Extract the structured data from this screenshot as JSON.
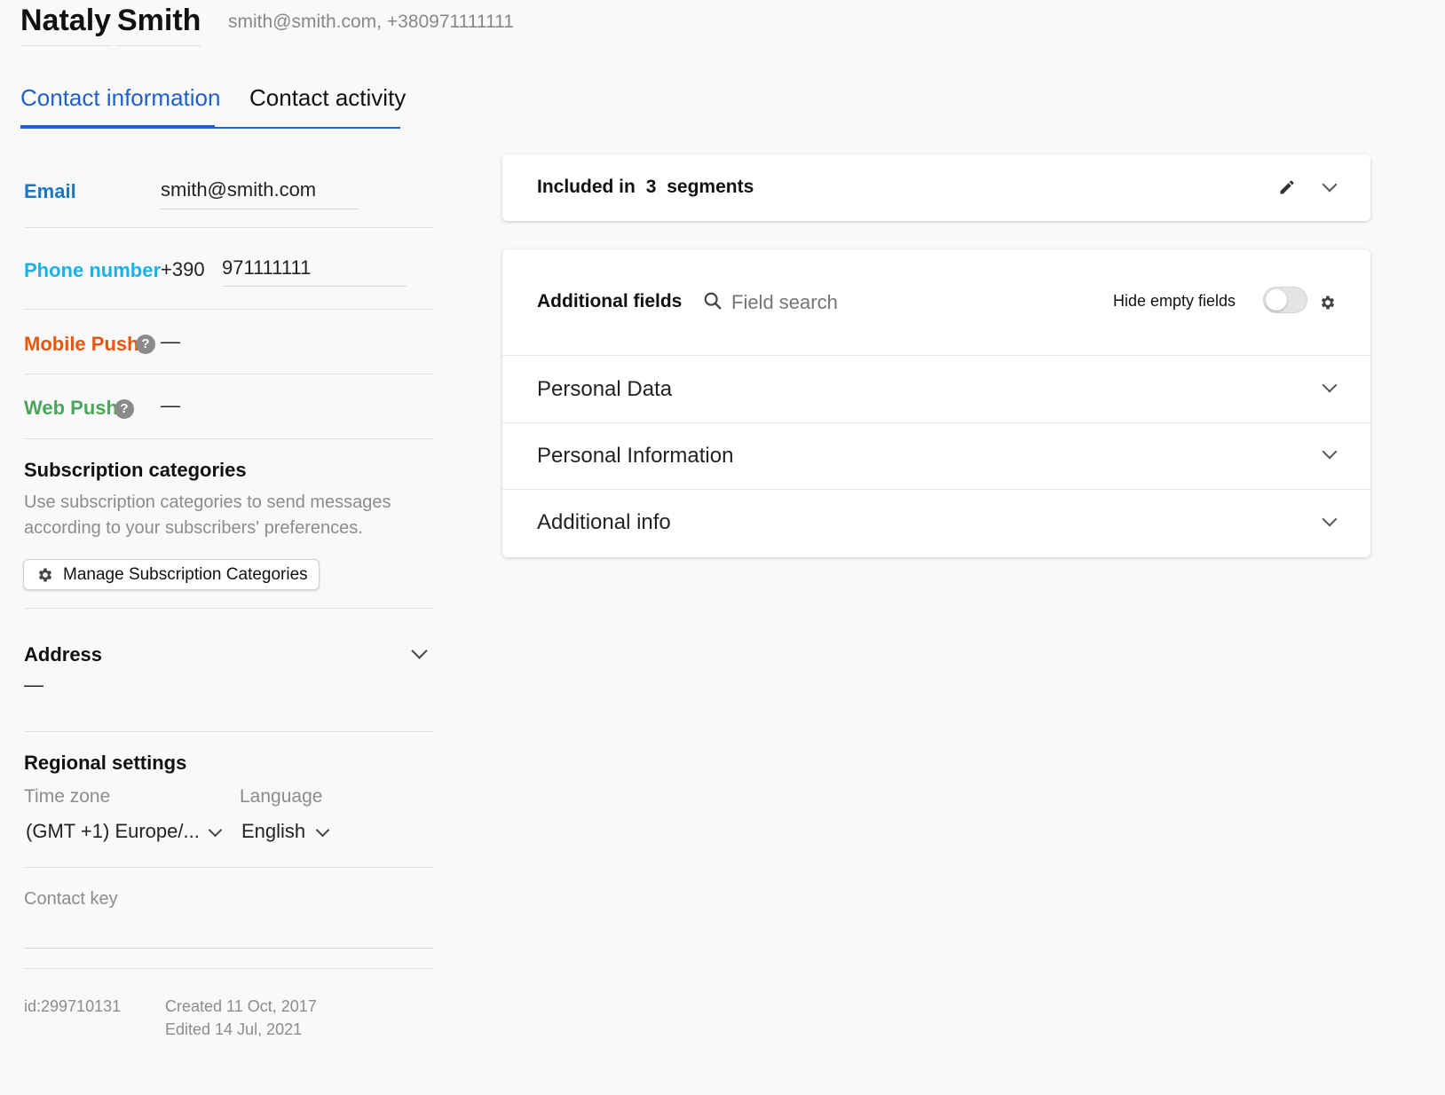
{
  "header": {
    "first_name": "Nataly",
    "last_name": "Smith",
    "contact_summary": "smith@smith.com, +380971111111"
  },
  "tabs": [
    {
      "label": "Contact information",
      "active": true
    },
    {
      "label": "Contact activity",
      "active": false
    }
  ],
  "colors": {
    "accent": "#1f5fcf",
    "email_label": "#1b76c4",
    "phone_label": "#1ab0e8",
    "mobile_push_label": "#e5570e",
    "web_push_label": "#4aa65a"
  },
  "contact": {
    "email_label": "Email",
    "email_value": "smith@smith.com",
    "phone_label": "Phone number",
    "phone_code": "+390",
    "phone_number": "971111111",
    "mobile_push_label": "Mobile Push",
    "mobile_push_value": "—",
    "web_push_label": "Web Push",
    "web_push_value": "—",
    "help_glyph": "?"
  },
  "subscription": {
    "title": "Subscription categories",
    "description_line1": "Use subscription categories to send messages",
    "description_line2": "according to your subscribers' preferences.",
    "button_label": "Manage Subscription Categories",
    "button_icon": "gear-icon"
  },
  "address": {
    "title": "Address",
    "value": "—"
  },
  "regional": {
    "title": "Regional settings",
    "timezone_label": "Time zone",
    "timezone_value": "(GMT +1) Europe/...",
    "language_label": "Language",
    "language_value": "English"
  },
  "contact_key": {
    "label": "Contact key"
  },
  "meta": {
    "id": "id:299710131",
    "created": "Created 11 Oct, 2017",
    "edited": "Edited 14 Jul, 2021"
  },
  "segments": {
    "prefix": "Included in",
    "count": "3",
    "suffix": "segments",
    "edit_icon": "pencil-icon",
    "expand_icon": "chevron-down-icon"
  },
  "additional_fields": {
    "title": "Additional fields",
    "search_placeholder": "Field search",
    "hide_empty_label": "Hide empty fields",
    "hide_empty_enabled": false,
    "settings_icon": "gear-icon",
    "sections": [
      {
        "label": "Personal Data"
      },
      {
        "label": "Personal Information"
      },
      {
        "label": "Additional info"
      }
    ]
  }
}
